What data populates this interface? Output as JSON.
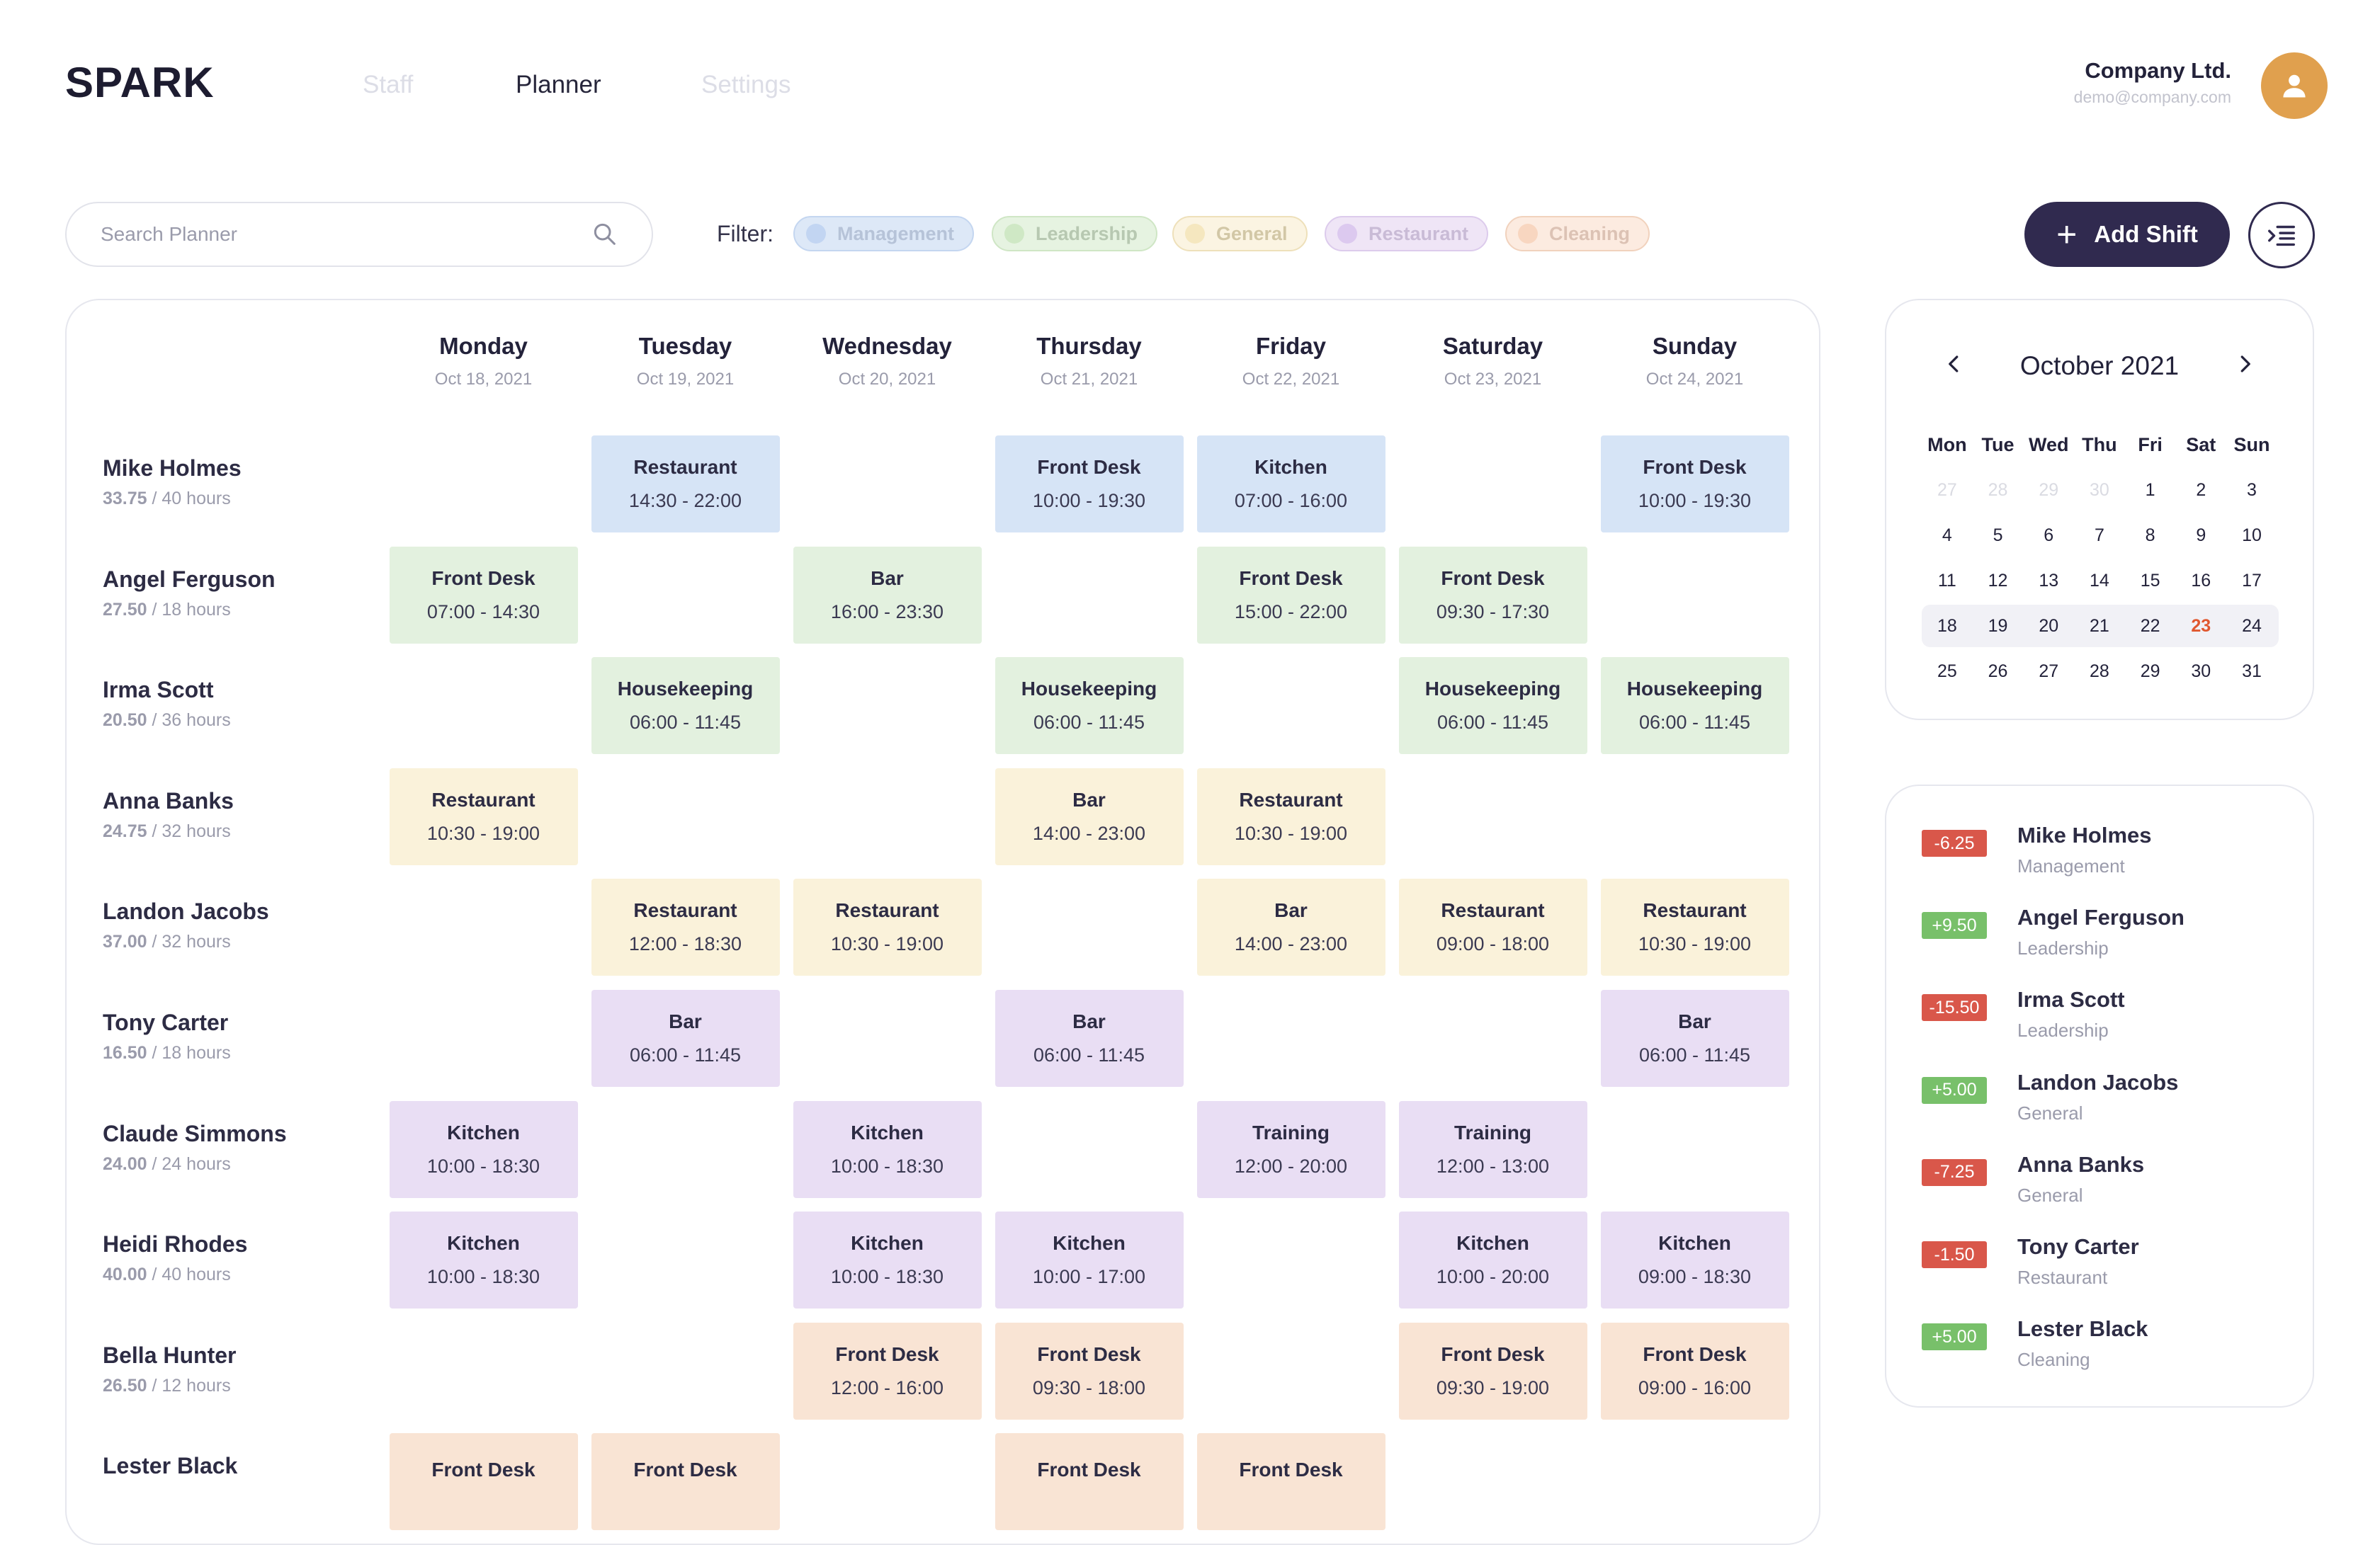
{
  "brand": "SPARK",
  "nav": [
    {
      "label": "Staff",
      "active": false
    },
    {
      "label": "Planner",
      "active": true
    },
    {
      "label": "Settings",
      "active": false
    }
  ],
  "company": {
    "name": "Company Ltd.",
    "email": "demo@company.com"
  },
  "search": {
    "placeholder": "Search Planner"
  },
  "filter": {
    "label": "Filter:",
    "chips": [
      {
        "label": "Management",
        "bg": "#dde8f7",
        "border": "#c4d6f0",
        "dot": "#c2d5f2",
        "text": "#b6c3d8"
      },
      {
        "label": "Leadership",
        "bg": "#e6f3e1",
        "border": "#cfe6c5",
        "dot": "#cfe8c5",
        "text": "#b7c8b1"
      },
      {
        "label": "General",
        "bg": "#fbf4e2",
        "border": "#eee0ba",
        "dot": "#f5e7bf",
        "text": "#d2c7a6"
      },
      {
        "label": "Restaurant",
        "bg": "#efe5f6",
        "border": "#dccbec",
        "dot": "#dcc9ef",
        "text": "#c9bbd6"
      },
      {
        "label": "Cleaning",
        "bg": "#fcebe0",
        "border": "#f1d2bd",
        "dot": "#f8d6c0",
        "text": "#dcc2b4"
      }
    ]
  },
  "add_shift_label": "Add Shift",
  "days": [
    {
      "name": "Monday",
      "date": "Oct 18, 2021"
    },
    {
      "name": "Tuesday",
      "date": "Oct 19, 2021"
    },
    {
      "name": "Wednesday",
      "date": "Oct 20, 2021"
    },
    {
      "name": "Thursday",
      "date": "Oct 21, 2021"
    },
    {
      "name": "Friday",
      "date": "Oct 22, 2021"
    },
    {
      "name": "Saturday",
      "date": "Oct 23, 2021"
    },
    {
      "name": "Sunday",
      "date": "Oct 24, 2021"
    }
  ],
  "hours_separator": " / ",
  "hours_suffix": " hours",
  "colors": {
    "blue": "#d6e4f6",
    "green": "#e3f1df",
    "yellow": "#faf2da",
    "purple": "#e9def4",
    "peach": "#f9e4d4",
    "badge_negative": "#d9574a",
    "badge_positive": "#78c06a"
  },
  "staff": [
    {
      "name": "Mike Holmes",
      "worked": "33.75",
      "target": "40",
      "shifts": [
        {
          "day": 1,
          "role": "Restaurant",
          "time": "14:30 - 22:00",
          "color": "blue"
        },
        {
          "day": 3,
          "role": "Front Desk",
          "time": "10:00 - 19:30",
          "color": "blue"
        },
        {
          "day": 4,
          "role": "Kitchen",
          "time": "07:00 - 16:00",
          "color": "blue"
        },
        {
          "day": 6,
          "role": "Front Desk",
          "time": "10:00 - 19:30",
          "color": "blue"
        }
      ]
    },
    {
      "name": "Angel Ferguson",
      "worked": "27.50",
      "target": "18",
      "shifts": [
        {
          "day": 0,
          "role": "Front Desk",
          "time": "07:00 - 14:30",
          "color": "green"
        },
        {
          "day": 2,
          "role": "Bar",
          "time": "16:00 - 23:30",
          "color": "green"
        },
        {
          "day": 4,
          "role": "Front Desk",
          "time": "15:00 - 22:00",
          "color": "green"
        },
        {
          "day": 5,
          "role": "Front Desk",
          "time": "09:30 - 17:30",
          "color": "green"
        }
      ]
    },
    {
      "name": "Irma Scott",
      "worked": "20.50",
      "target": "36",
      "shifts": [
        {
          "day": 1,
          "role": "Housekeeping",
          "time": "06:00 - 11:45",
          "color": "green"
        },
        {
          "day": 3,
          "role": "Housekeeping",
          "time": "06:00 - 11:45",
          "color": "green"
        },
        {
          "day": 5,
          "role": "Housekeeping",
          "time": "06:00 - 11:45",
          "color": "green"
        },
        {
          "day": 6,
          "role": "Housekeeping",
          "time": "06:00 - 11:45",
          "color": "green"
        }
      ]
    },
    {
      "name": "Anna Banks",
      "worked": "24.75",
      "target": "32",
      "shifts": [
        {
          "day": 0,
          "role": "Restaurant",
          "time": "10:30 - 19:00",
          "color": "yellow"
        },
        {
          "day": 3,
          "role": "Bar",
          "time": "14:00 - 23:00",
          "color": "yellow"
        },
        {
          "day": 4,
          "role": "Restaurant",
          "time": "10:30 - 19:00",
          "color": "yellow"
        }
      ]
    },
    {
      "name": "Landon Jacobs",
      "worked": "37.00",
      "target": "32",
      "shifts": [
        {
          "day": 1,
          "role": "Restaurant",
          "time": "12:00 - 18:30",
          "color": "yellow"
        },
        {
          "day": 2,
          "role": "Restaurant",
          "time": "10:30 - 19:00",
          "color": "yellow"
        },
        {
          "day": 4,
          "role": "Bar",
          "time": "14:00 - 23:00",
          "color": "yellow"
        },
        {
          "day": 5,
          "role": "Restaurant",
          "time": "09:00 - 18:00",
          "color": "yellow"
        },
        {
          "day": 6,
          "role": "Restaurant",
          "time": "10:30 - 19:00",
          "color": "yellow"
        }
      ]
    },
    {
      "name": "Tony Carter",
      "worked": "16.50",
      "target": "18",
      "shifts": [
        {
          "day": 1,
          "role": "Bar",
          "time": "06:00 - 11:45",
          "color": "purple"
        },
        {
          "day": 3,
          "role": "Bar",
          "time": "06:00 - 11:45",
          "color": "purple"
        },
        {
          "day": 6,
          "role": "Bar",
          "time": "06:00 - 11:45",
          "color": "purple"
        }
      ]
    },
    {
      "name": "Claude Simmons",
      "worked": "24.00",
      "target": "24",
      "shifts": [
        {
          "day": 0,
          "role": "Kitchen",
          "time": "10:00 - 18:30",
          "color": "purple"
        },
        {
          "day": 2,
          "role": "Kitchen",
          "time": "10:00 - 18:30",
          "color": "purple"
        },
        {
          "day": 4,
          "role": "Training",
          "time": "12:00 - 20:00",
          "color": "purple"
        },
        {
          "day": 5,
          "role": "Training",
          "time": "12:00 - 13:00",
          "color": "purple"
        }
      ]
    },
    {
      "name": "Heidi Rhodes",
      "worked": "40.00",
      "target": "40",
      "shifts": [
        {
          "day": 0,
          "role": "Kitchen",
          "time": "10:00 - 18:30",
          "color": "purple"
        },
        {
          "day": 2,
          "role": "Kitchen",
          "time": "10:00 - 18:30",
          "color": "purple"
        },
        {
          "day": 3,
          "role": "Kitchen",
          "time": "10:00 - 17:00",
          "color": "purple"
        },
        {
          "day": 5,
          "role": "Kitchen",
          "time": "10:00 - 20:00",
          "color": "purple"
        },
        {
          "day": 6,
          "role": "Kitchen",
          "time": "09:00 - 18:30",
          "color": "purple"
        }
      ]
    },
    {
      "name": "Bella Hunter",
      "worked": "26.50",
      "target": "12",
      "shifts": [
        {
          "day": 2,
          "role": "Front Desk",
          "time": "12:00 - 16:00",
          "color": "peach"
        },
        {
          "day": 3,
          "role": "Front Desk",
          "time": "09:30 - 18:00",
          "color": "peach"
        },
        {
          "day": 5,
          "role": "Front Desk",
          "time": "09:30 - 19:00",
          "color": "peach"
        },
        {
          "day": 6,
          "role": "Front Desk",
          "time": "09:00 - 16:00",
          "color": "peach"
        }
      ]
    },
    {
      "name": "Lester Black",
      "worked": null,
      "target": null,
      "shifts": [
        {
          "day": 0,
          "role": "Front Desk",
          "time": null,
          "color": "peach"
        },
        {
          "day": 1,
          "role": "Front Desk",
          "time": null,
          "color": "peach"
        },
        {
          "day": 3,
          "role": "Front Desk",
          "time": null,
          "color": "peach"
        },
        {
          "day": 4,
          "role": "Front Desk",
          "time": null,
          "color": "peach"
        }
      ]
    }
  ],
  "calendar": {
    "title": "October 2021",
    "weekdays": [
      "Mon",
      "Tue",
      "Wed",
      "Thu",
      "Fri",
      "Sat",
      "Sun"
    ],
    "weeks": [
      [
        {
          "d": "27",
          "muted": true
        },
        {
          "d": "28",
          "muted": true
        },
        {
          "d": "29",
          "muted": true
        },
        {
          "d": "30",
          "muted": true
        },
        {
          "d": "1"
        },
        {
          "d": "2"
        },
        {
          "d": "3"
        }
      ],
      [
        {
          "d": "4"
        },
        {
          "d": "5"
        },
        {
          "d": "6"
        },
        {
          "d": "7"
        },
        {
          "d": "8"
        },
        {
          "d": "9"
        },
        {
          "d": "10"
        }
      ],
      [
        {
          "d": "11"
        },
        {
          "d": "12"
        },
        {
          "d": "13"
        },
        {
          "d": "14"
        },
        {
          "d": "15"
        },
        {
          "d": "16"
        },
        {
          "d": "17"
        }
      ],
      [
        {
          "d": "18"
        },
        {
          "d": "19"
        },
        {
          "d": "20"
        },
        {
          "d": "21"
        },
        {
          "d": "22"
        },
        {
          "d": "23",
          "today": true
        },
        {
          "d": "24"
        }
      ],
      [
        {
          "d": "25"
        },
        {
          "d": "26"
        },
        {
          "d": "27"
        },
        {
          "d": "28"
        },
        {
          "d": "29"
        },
        {
          "d": "30"
        },
        {
          "d": "31"
        }
      ]
    ],
    "selected_week": 3
  },
  "balances": [
    {
      "value": "-6.25",
      "sign": "negative",
      "name": "Mike Holmes",
      "group": "Management"
    },
    {
      "value": "+9.50",
      "sign": "positive",
      "name": "Angel Ferguson",
      "group": "Leadership"
    },
    {
      "value": "-15.50",
      "sign": "negative",
      "name": "Irma Scott",
      "group": "Leadership"
    },
    {
      "value": "+5.00",
      "sign": "positive",
      "name": "Landon Jacobs",
      "group": "General"
    },
    {
      "value": "-7.25",
      "sign": "negative",
      "name": "Anna Banks",
      "group": "General"
    },
    {
      "value": "-1.50",
      "sign": "negative",
      "name": "Tony Carter",
      "group": "Restaurant"
    },
    {
      "value": "+5.00",
      "sign": "positive",
      "name": "Lester Black",
      "group": "Cleaning"
    }
  ]
}
